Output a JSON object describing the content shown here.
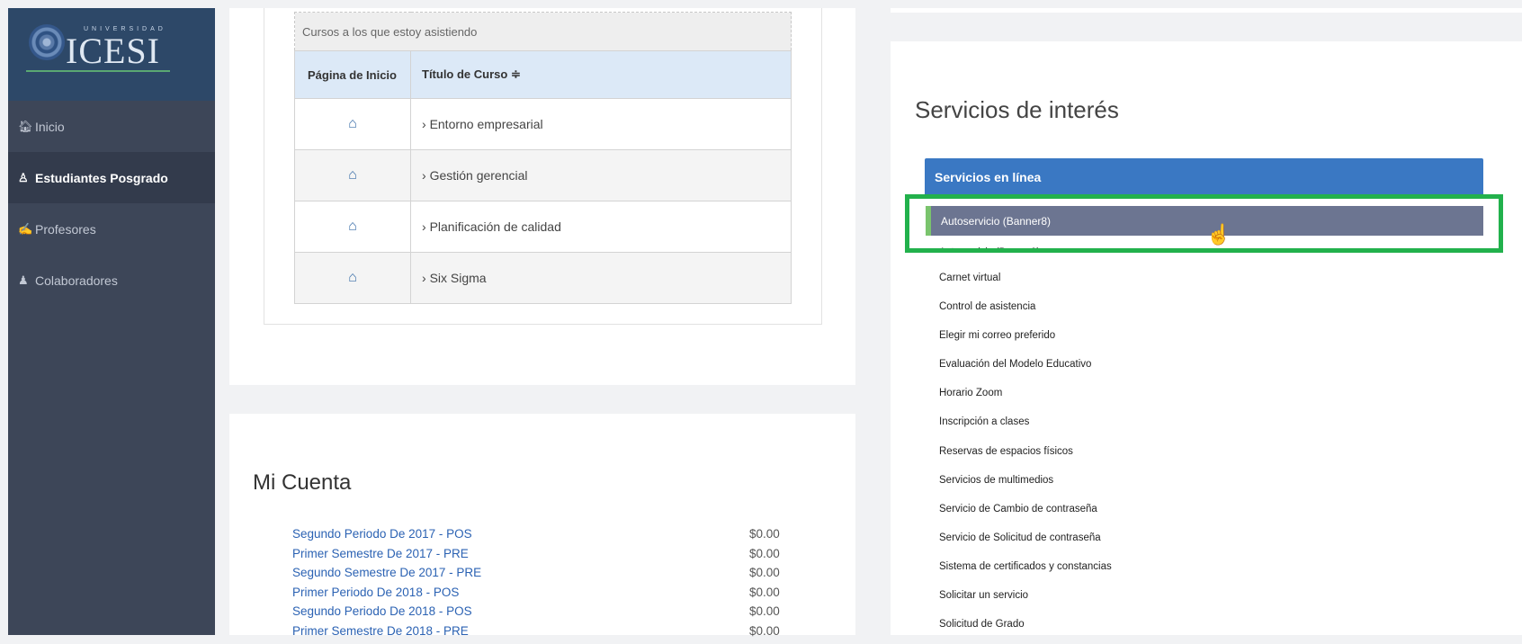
{
  "sidebar": {
    "logo": {
      "university": "UNIVERSIDAD",
      "name": "ICESI"
    },
    "items": [
      {
        "label": "Inicio",
        "icon": "home-icon",
        "active": false
      },
      {
        "label": "Estudiantes Posgrado",
        "icon": "student-icon",
        "active": true
      },
      {
        "label": "Profesores",
        "icon": "teacher-icon",
        "active": false
      },
      {
        "label": "Colaboradores",
        "icon": "users-icon",
        "active": false
      }
    ]
  },
  "courses": {
    "caption": "Cursos a los que estoy asistiendo",
    "headers": {
      "home": "Página de Inicio",
      "title": "Título de Curso ≑"
    },
    "rows": [
      {
        "title": "Entorno empresarial"
      },
      {
        "title": "Gestión gerencial"
      },
      {
        "title": "Planificación de calidad"
      },
      {
        "title": "Six Sigma"
      }
    ]
  },
  "account": {
    "title": "Mi Cuenta",
    "rows": [
      {
        "name": "Segundo Periodo De 2017 - POS",
        "amount": "$0.00"
      },
      {
        "name": "Primer Semestre De 2017 - PRE",
        "amount": "$0.00"
      },
      {
        "name": "Segundo Semestre De 2017 - PRE",
        "amount": "$0.00"
      },
      {
        "name": "Primer Periodo De 2018 - POS",
        "amount": "$0.00"
      },
      {
        "name": "Segundo Periodo De 2018 - POS",
        "amount": "$0.00"
      },
      {
        "name": "Primer Semestre De 2018 - PRE",
        "amount": "$0.00"
      }
    ]
  },
  "services": {
    "title": "Servicios de interés",
    "header": "Servicios en línea",
    "active": "Autoservicio (Banner8)",
    "partial": "Autoservicio (Banner9)",
    "items": [
      "Carnet virtual",
      "Control de asistencia",
      "Elegir mi correo preferido",
      "Evaluación del Modelo Educativo",
      "Horario Zoom",
      "Inscripción a clases",
      "Reservas de espacios físicos",
      "Servicios de multimedios",
      "Servicio de Cambio de contraseña",
      "Servicio de Solicitud de contraseña",
      "Sistema de certificados y constancias",
      "Solicitar un servicio",
      "Solicitud de Grado"
    ]
  },
  "colors": {
    "sidebar": "#3d4658",
    "header_blue": "#3a78c3",
    "highlight": "#22b14c",
    "link": "#2b62b3"
  }
}
